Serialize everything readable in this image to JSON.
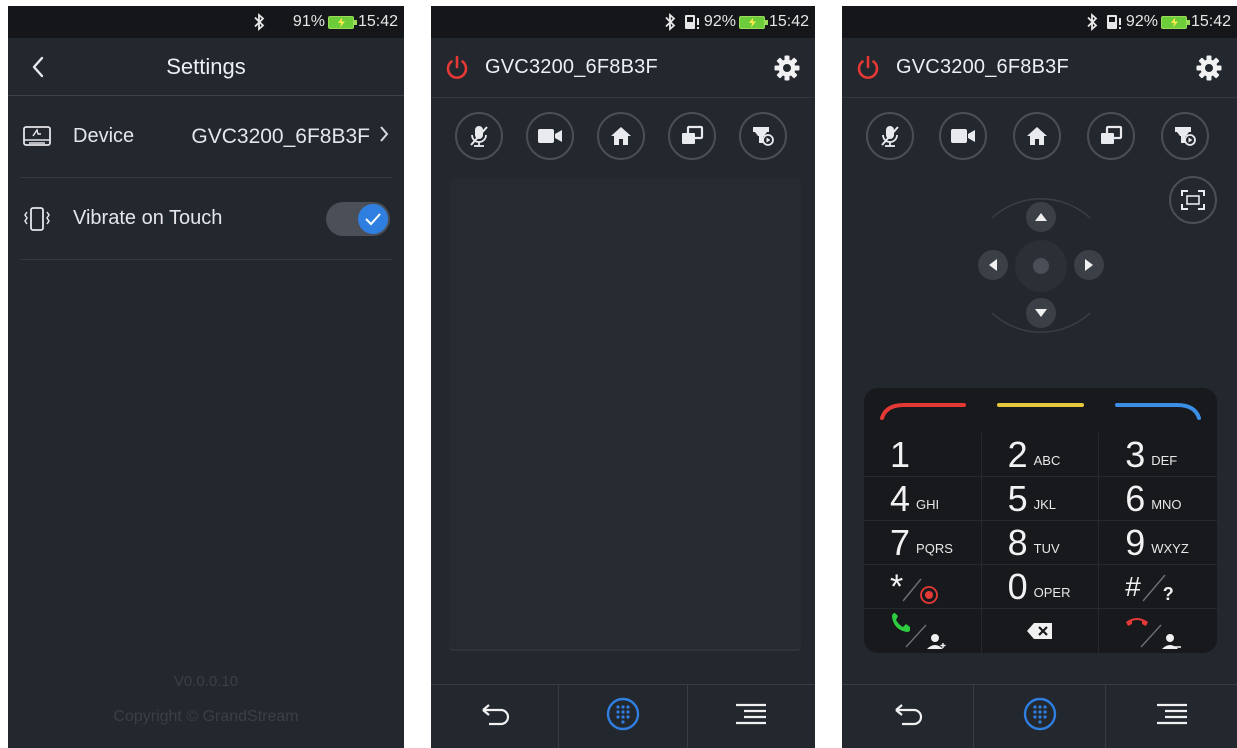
{
  "colors": {
    "accent_blue": "#2f7fe0",
    "power_red": "#e53935",
    "bar_red": "#e53935",
    "bar_yellow": "#e6c63a",
    "bar_blue": "#3a8ee6",
    "call_green": "#2ecc40",
    "screen_bg": "#23272e"
  },
  "settings_screen": {
    "status": {
      "battery": "91%",
      "time": "15:42"
    },
    "title": "Settings",
    "back_icon": "chevron-left-icon",
    "device_row": {
      "icon": "device-icon",
      "label": "Device",
      "value": "GVC3200_6F8B3F"
    },
    "vibrate_row": {
      "icon": "vibrate-icon",
      "label": "Vibrate on Touch",
      "enabled": true
    },
    "version": "V0.0.0.10",
    "copyright": "Copyright © GrandStream"
  },
  "touchpad_screen": {
    "status": {
      "battery": "92%",
      "time": "15:42"
    },
    "device_name": "GVC3200_6F8B3F",
    "quick_buttons": [
      "mic-mute-icon",
      "video-icon",
      "home-icon",
      "presentation-icon",
      "record-icon"
    ]
  },
  "dialpad_screen": {
    "status": {
      "battery": "92%",
      "time": "15:42"
    },
    "device_name": "GVC3200_6F8B3F",
    "keys": [
      {
        "num": "1",
        "letters": ""
      },
      {
        "num": "2",
        "letters": "ABC"
      },
      {
        "num": "3",
        "letters": "DEF"
      },
      {
        "num": "4",
        "letters": "GHI"
      },
      {
        "num": "5",
        "letters": "JKL"
      },
      {
        "num": "6",
        "letters": "MNO"
      },
      {
        "num": "7",
        "letters": "PQRS"
      },
      {
        "num": "8",
        "letters": "TUV"
      },
      {
        "num": "9",
        "letters": "WXYZ"
      },
      {
        "num": "*",
        "letters": ""
      },
      {
        "num": "0",
        "letters": "OPER"
      },
      {
        "num": "#",
        "letters": "?"
      }
    ]
  },
  "bottom_nav": [
    "back-icon",
    "dialpad-icon",
    "menu-icon"
  ]
}
